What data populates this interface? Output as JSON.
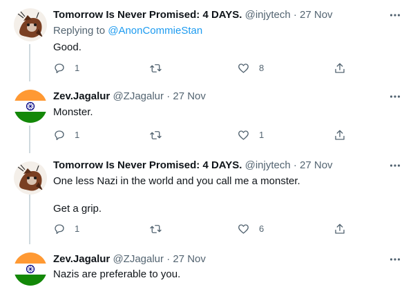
{
  "tweets": [
    {
      "name": "Tomorrow Is Never Promised: 4 DAYS.",
      "handle": "@injytech",
      "sep": "·",
      "date": "27 Nov",
      "replying_prefix": "Replying to",
      "replying_to": "@AnonCommieStan",
      "lines": [
        "Good."
      ],
      "reply_count": "1",
      "retweet_count": "",
      "like_count": "8"
    },
    {
      "name": "Zev.Jagalur",
      "handle": "@ZJagalur",
      "sep": "·",
      "date": "27 Nov",
      "lines": [
        "Monster."
      ],
      "reply_count": "1",
      "retweet_count": "",
      "like_count": "1"
    },
    {
      "name": "Tomorrow Is Never Promised: 4 DAYS.",
      "handle": "@injytech",
      "sep": "·",
      "date": "27 Nov",
      "lines": [
        "One less Nazi in the world and you call me a monster.",
        "Get a grip."
      ],
      "reply_count": "1",
      "retweet_count": "",
      "like_count": "6"
    },
    {
      "name": "Zev.Jagalur",
      "handle": "@ZJagalur",
      "sep": "·",
      "date": "27 Nov",
      "lines": [
        "Nazis are preferable to you."
      ]
    }
  ],
  "colors": {
    "text": "#0f1419",
    "secondary": "#536471",
    "link": "#1d9bf0",
    "thread_line": "#cfd9de",
    "saffron": "#ff9933",
    "green": "#138808",
    "chakra": "#000080"
  },
  "icons": {
    "more": "more-horizontal-icon",
    "reply": "reply-bubble-icon",
    "retweet": "retweet-icon",
    "like": "heart-icon",
    "share": "share-upload-icon"
  }
}
